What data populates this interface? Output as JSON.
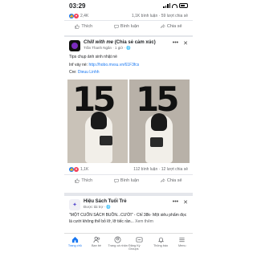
{
  "status_bar": {
    "time": "03:29"
  },
  "post_prev": {
    "reaction_count": "2,4K",
    "comments": "1,1K bình luận",
    "shares": "59 lượt chia sẻ"
  },
  "actions": {
    "like": "Thích",
    "comment": "Bình luận",
    "share": "Chia sẻ"
  },
  "post_main": {
    "page_name": "Chill with me",
    "group_suffix": "(Chia sẻ cảm xúc)",
    "author_time": "Trần Thanh Ngân · 1 giờ · ",
    "caption": "Tips chụp ảnh sinh nhật nè",
    "inf_label": "Inf váy nè: ",
    "inf_link": "http://hobo.mvsu.vn/61F3fcs",
    "cre_label": "Cre: ",
    "cre_link": "Dieuu Linhh",
    "photo_numbers": [
      "15",
      "15"
    ],
    "reaction_count": "1,1K",
    "comments": "112 bình luận",
    "shares": "12 lượt chia sẻ"
  },
  "post_next": {
    "page_name": "Hiệu Sách Tuổi Trẻ",
    "sponsored": "Được tài trợ · ",
    "text": "\"MỘT CUỐN SÁCH BUỒN...CƯỜI\" - Chỉ 38k- Một siêu phẩm đọc là cười không thể bỏ lỡ, lỡ tiếc rần...",
    "more": "Xem thêm"
  },
  "bottom_nav": [
    {
      "label": "Trang chủ",
      "icon": "home-icon"
    },
    {
      "label": "Bạn bè",
      "icon": "friends-icon"
    },
    {
      "label": "Trang cá nhân",
      "icon": "profile-icon"
    },
    {
      "label": "Đăng Ký Groups",
      "icon": "groups-icon"
    },
    {
      "label": "Thông báo",
      "icon": "bell-icon"
    },
    {
      "label": "Menu",
      "icon": "menu-icon"
    }
  ],
  "colors": {
    "accent": "#1877f2",
    "like": "#1877f2",
    "heart": "#f33e58"
  }
}
